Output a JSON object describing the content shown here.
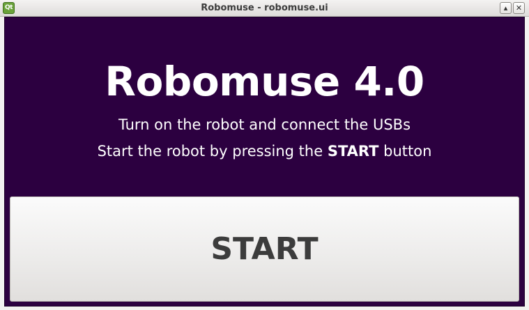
{
  "window": {
    "title": "Robomuse - robomuse.ui",
    "app_icon_text": "Qt",
    "maximize_glyph": "▴",
    "close_glyph": "✕"
  },
  "main": {
    "heading": "Robomuse 4.0",
    "instruction_1": "Turn on the robot and connect the USBs",
    "instruction_2_prefix": "Start the robot by pressing the ",
    "instruction_2_bold": "START",
    "instruction_2_suffix": " button",
    "start_button_label": "START"
  },
  "colors": {
    "background": "#2c0040",
    "text": "#ffffff",
    "button_text": "#3c3c3c"
  },
  "icons": {
    "app": "qt-designer-icon",
    "maximize": "maximize-icon",
    "close": "close-icon"
  }
}
